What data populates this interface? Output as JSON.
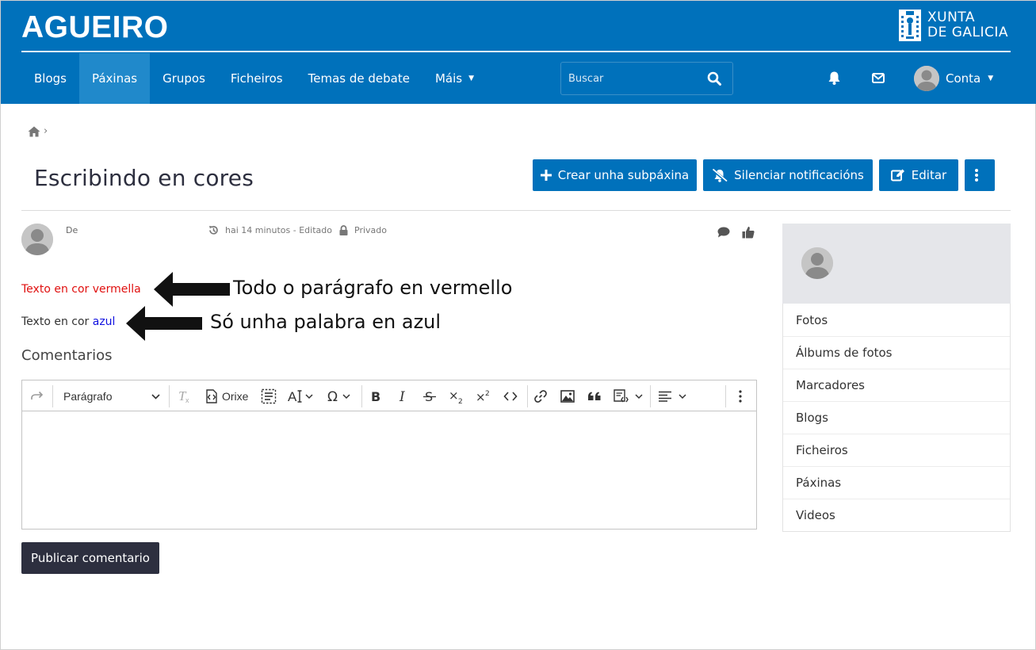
{
  "header": {
    "site_title": "AGUEIRO",
    "brand_line1": "XUNTA",
    "brand_line2": "DE GALICIA",
    "nav": [
      {
        "label": "Blogs"
      },
      {
        "label": "Páxinas",
        "active": true
      },
      {
        "label": "Grupos"
      },
      {
        "label": "Ficheiros"
      },
      {
        "label": "Temas de debate"
      },
      {
        "label": "Máis",
        "dropdown": true
      }
    ],
    "search_placeholder": "Buscar",
    "account_label": "Conta",
    "icons": [
      "bell-icon",
      "envelope-icon",
      "search-icon"
    ],
    "colors": {
      "primary": "#0071bb",
      "active_nav": "#2089cb"
    }
  },
  "breadcrumb": {
    "separator": "›"
  },
  "page": {
    "title": "Escribindo en cores",
    "actions": {
      "create_subpage": "Crear unha subpáxina",
      "mute_notifications": "Silenciar notificacións",
      "edit": "Editar"
    }
  },
  "post": {
    "by_label": "De",
    "time": "hai 14 minutos - Editado",
    "privacy": "Privado",
    "para1": "Texto en cor vermella",
    "para2_prefix": "Texto en cor ",
    "para2_blue_word": "azul",
    "text_colors": {
      "red": "#e0100f",
      "blue": "#1010e0"
    },
    "annotation1": "Todo o parágrafo en vermello",
    "annotation2": "Só unha palabra en azul"
  },
  "comments": {
    "heading": "Comentarios",
    "editor": {
      "block_format": "Parágrafo",
      "source_label": "Orixe"
    },
    "publish_label": "Publicar comentario"
  },
  "sidebar": {
    "items": [
      {
        "label": "Fotos"
      },
      {
        "label": "Álbums de fotos"
      },
      {
        "label": "Marcadores"
      },
      {
        "label": "Blogs"
      },
      {
        "label": "Ficheiros"
      },
      {
        "label": "Páxinas"
      },
      {
        "label": "Videos"
      }
    ]
  }
}
